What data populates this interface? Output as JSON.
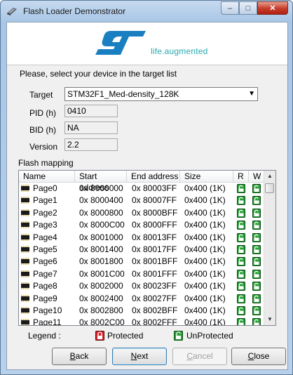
{
  "window": {
    "title": "Flash Loader Demonstrator",
    "controls": {
      "minimize": "–",
      "maximize": "□",
      "close": "✕"
    }
  },
  "banner": {
    "tagline": "life.augmented"
  },
  "prompt": "Please, select your device in the target list",
  "target": {
    "label": "Target",
    "value": "STM32F1_Med-density_128K"
  },
  "pid": {
    "label": "PID  (h)",
    "value": "0410"
  },
  "bid": {
    "label": "BID  (h)",
    "value": "NA"
  },
  "version": {
    "label": "Version",
    "value": "2.2"
  },
  "flash_mapping": {
    "label": "Flash mapping",
    "columns": [
      "Name",
      "Start address",
      "End address",
      "Size",
      "R",
      "W"
    ],
    "rows": [
      {
        "name": "Page0",
        "start": "0x 8000000",
        "end": "0x 80003FF",
        "size": "0x400 (1K)"
      },
      {
        "name": "Page1",
        "start": "0x 8000400",
        "end": "0x 80007FF",
        "size": "0x400 (1K)"
      },
      {
        "name": "Page2",
        "start": "0x 8000800",
        "end": "0x 8000BFF",
        "size": "0x400 (1K)"
      },
      {
        "name": "Page3",
        "start": "0x 8000C00",
        "end": "0x 8000FFF",
        "size": "0x400 (1K)"
      },
      {
        "name": "Page4",
        "start": "0x 8001000",
        "end": "0x 80013FF",
        "size": "0x400 (1K)"
      },
      {
        "name": "Page5",
        "start": "0x 8001400",
        "end": "0x 80017FF",
        "size": "0x400 (1K)"
      },
      {
        "name": "Page6",
        "start": "0x 8001800",
        "end": "0x 8001BFF",
        "size": "0x400 (1K)"
      },
      {
        "name": "Page7",
        "start": "0x 8001C00",
        "end": "0x 8001FFF",
        "size": "0x400 (1K)"
      },
      {
        "name": "Page8",
        "start": "0x 8002000",
        "end": "0x 80023FF",
        "size": "0x400 (1K)"
      },
      {
        "name": "Page9",
        "start": "0x 8002400",
        "end": "0x 80027FF",
        "size": "0x400 (1K)"
      },
      {
        "name": "Page10",
        "start": "0x 8002800",
        "end": "0x 8002BFF",
        "size": "0x400 (1K)"
      },
      {
        "name": "Page11",
        "start": "0x 8002C00",
        "end": "0x 8002FFF",
        "size": "0x400 (1K)"
      }
    ]
  },
  "legend": {
    "label": "Legend :",
    "protected": "Protected",
    "unprotected": "UnProtected"
  },
  "buttons": {
    "back": {
      "underline": "B",
      "rest": "ack"
    },
    "next": {
      "underline": "N",
      "rest": "ext"
    },
    "cancel": {
      "underline": "C",
      "rest": "ancel"
    },
    "close": {
      "underline": "C",
      "rest": "lose"
    }
  },
  "colors": {
    "accent": "#1a7fc1",
    "tagline": "#2aa9b0",
    "protected": "#d9222a",
    "unprotected": "#27a035"
  }
}
